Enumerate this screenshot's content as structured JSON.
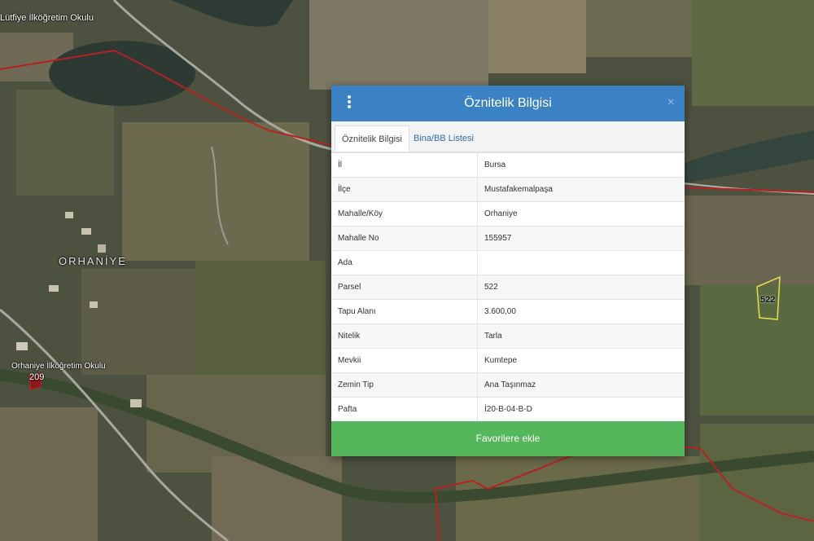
{
  "map": {
    "village_label": "ORHANİYE",
    "school_label_top": "Lütfiye İlköğretim Okulu",
    "school_label_bottom": "Orhaniye İlköğretim Okulu",
    "parcel_209": "209",
    "parcel_522": "522",
    "boundary_color": "#b8211f"
  },
  "dialog": {
    "title": "Öznitelik Bilgisi",
    "close_label": "×",
    "header_color": "#3b82c4",
    "tabs": [
      "Öznitelik Bilgisi",
      "Bina/BB Listesi"
    ],
    "rows": [
      {
        "key": "İl",
        "value": "Bursa"
      },
      {
        "key": "İlçe",
        "value": "Mustafakemalpaşa"
      },
      {
        "key": "Mahalle/Köy",
        "value": "Orhaniye"
      },
      {
        "key": "Mahalle No",
        "value": "155957"
      },
      {
        "key": "Ada",
        "value": ""
      },
      {
        "key": "Parsel",
        "value": "522"
      },
      {
        "key": "Tapu Alanı",
        "value": "3.600,00"
      },
      {
        "key": "Nitelik",
        "value": "Tarla"
      },
      {
        "key": "Mevkii",
        "value": "Kumtepe"
      },
      {
        "key": "Zemin Tip",
        "value": "Ana Taşınmaz"
      },
      {
        "key": "Pafta",
        "value": "İ20-B-04-B-D"
      }
    ],
    "favorite_button": "Favorilere ekle",
    "favorite_color": "#55b75c"
  }
}
